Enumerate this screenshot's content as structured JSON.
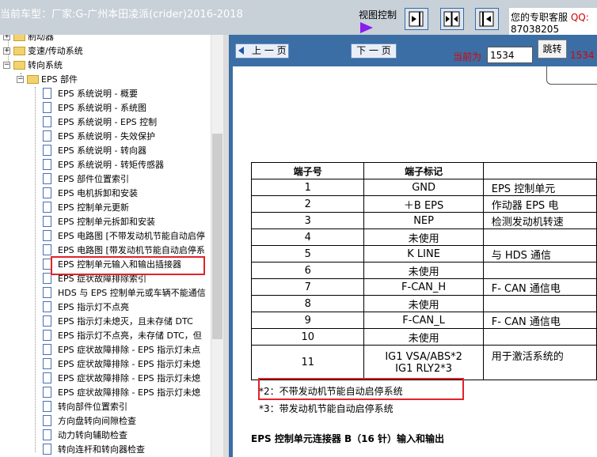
{
  "header": {
    "car_title": "当前车型：厂家:G-广州本田凌派(crider)2016-2018",
    "view_control_label": "视图控制",
    "service_label": "您的专职客服",
    "service_qq": "QQ:",
    "service_number": "87038205"
  },
  "tree": {
    "items": [
      {
        "label": "制动器",
        "type": "folder"
      },
      {
        "label": "变速/传动系统",
        "type": "folder"
      },
      {
        "label": "转向系统",
        "type": "folder"
      },
      {
        "label": "EPS 部件",
        "type": "folder"
      },
      {
        "label": "EPS 系统说明 - 概要",
        "type": "doc"
      },
      {
        "label": "EPS 系统说明 - 系统图",
        "type": "doc"
      },
      {
        "label": "EPS 系统说明 - EPS 控制",
        "type": "doc"
      },
      {
        "label": "EPS 系统说明 - 失效保护",
        "type": "doc"
      },
      {
        "label": "EPS 系统说明 - 转向器",
        "type": "doc"
      },
      {
        "label": "EPS 系统说明 - 转矩传感器",
        "type": "doc"
      },
      {
        "label": "EPS 部件位置索引",
        "type": "doc"
      },
      {
        "label": "EPS 电机拆卸和安装",
        "type": "doc"
      },
      {
        "label": "EPS 控制单元更新",
        "type": "doc"
      },
      {
        "label": "EPS 控制单元拆卸和安装",
        "type": "doc"
      },
      {
        "label": "EPS 电路图 [不带发动机节能自动启停",
        "type": "doc"
      },
      {
        "label": "EPS 电路图 [带发动机节能自动启停系",
        "type": "doc"
      },
      {
        "label": "EPS 控制单元输入和输出插接器",
        "type": "doc",
        "selected": true
      },
      {
        "label": "EPS 症状故障排除索引",
        "type": "doc"
      },
      {
        "label": "HDS 与 EPS 控制单元或车辆不能通信",
        "type": "doc"
      },
      {
        "label": "EPS 指示灯不点亮",
        "type": "doc"
      },
      {
        "label": "EPS 指示灯未熄灭，且未存储 DTC",
        "type": "doc"
      },
      {
        "label": "EPS 指示灯不点亮，未存储 DTC，但",
        "type": "doc"
      },
      {
        "label": "EPS 症状故障排除 - EPS 指示灯未点",
        "type": "doc"
      },
      {
        "label": "EPS 症状故障排除 - EPS 指示灯未熄",
        "type": "doc"
      },
      {
        "label": "EPS 症状故障排除 - EPS 指示灯未熄",
        "type": "doc"
      },
      {
        "label": "EPS 症状故障排除 - EPS 指示灯未熄",
        "type": "doc"
      },
      {
        "label": "转向部件位置索引",
        "type": "doc"
      },
      {
        "label": "方向盘转向间隙检查",
        "type": "doc"
      },
      {
        "label": "动力转向辅助检查",
        "type": "doc"
      },
      {
        "label": "转向连杆和转向器检查",
        "type": "doc"
      }
    ]
  },
  "nav": {
    "prev_label": "上 一 页",
    "next_label": "下 一 页",
    "current_label": "当前为",
    "page_value": "1534",
    "jump_label": "跳转",
    "total_label": "1534 /"
  },
  "content": {
    "table": {
      "headers": [
        "端子号",
        "端子标记",
        ""
      ],
      "rows": [
        {
          "no": "1",
          "mark": "GND",
          "desc": "EPS 控制单元"
        },
        {
          "no": "2",
          "mark": "＋B EPS",
          "desc": "作动器  EPS 电"
        },
        {
          "no": "3",
          "mark": "NEP",
          "desc": "检测发动机转速"
        },
        {
          "no": "4",
          "mark": "未使用",
          "desc": ""
        },
        {
          "no": "5",
          "mark": "K LINE",
          "desc": "与  HDS 通信"
        },
        {
          "no": "6",
          "mark": "未使用",
          "desc": ""
        },
        {
          "no": "7",
          "mark": "F-CAN_H",
          "desc": "F- CAN 通信电"
        },
        {
          "no": "8",
          "mark": "未使用",
          "desc": ""
        },
        {
          "no": "9",
          "mark": "F-CAN_L",
          "desc": "F- CAN 通信电"
        },
        {
          "no": "10",
          "mark": "未使用",
          "desc": ""
        },
        {
          "no": "11",
          "mark": "IG1 VSA/ABS*2",
          "mark2": "IG1 RLY2*3",
          "desc": "用于激活系统的"
        }
      ]
    },
    "footnote_1": "*2：不带发动机节能自动启停系统",
    "footnote_2": "*3：带发动机节能自动启停系统",
    "section_title": "EPS 控制单元连接器 B（16 针）输入和输出"
  }
}
